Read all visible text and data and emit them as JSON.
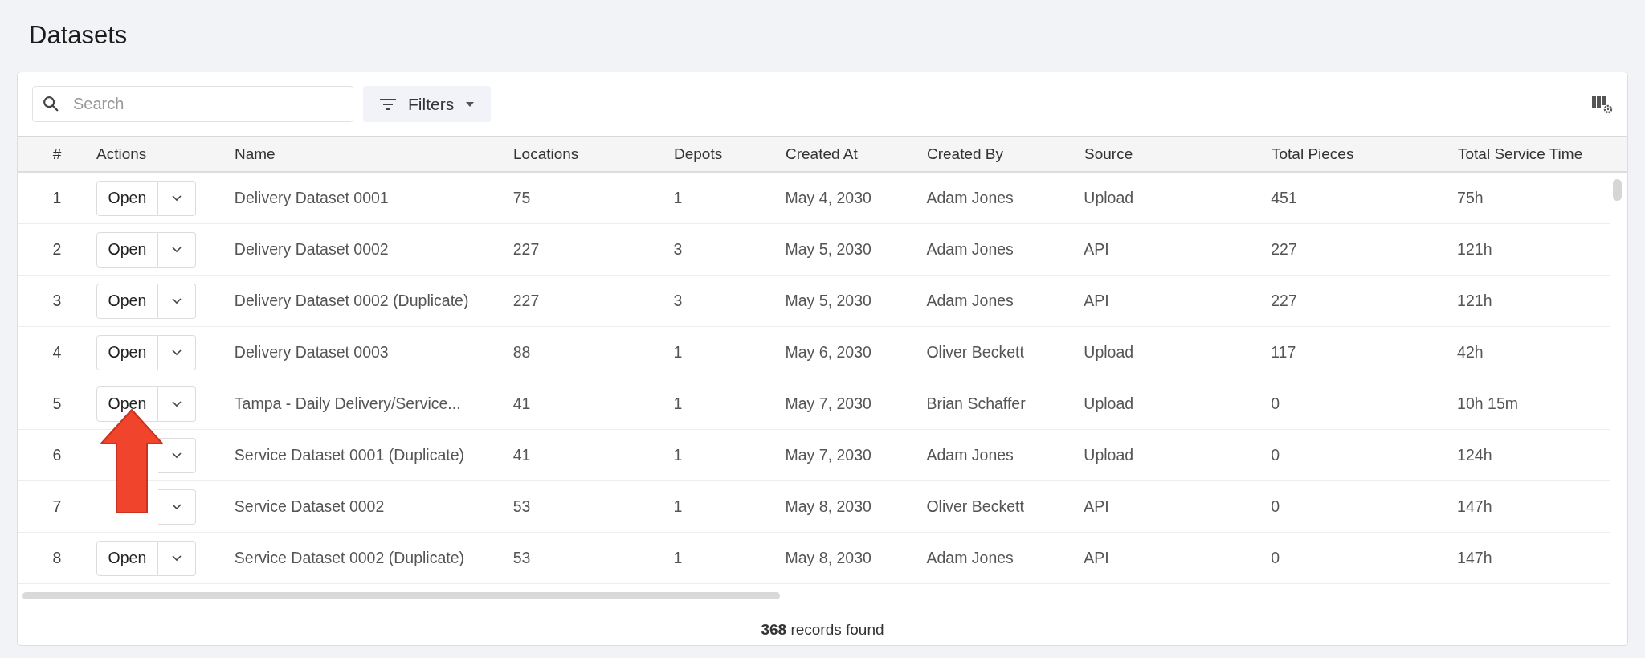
{
  "page": {
    "title": "Datasets"
  },
  "toolbar": {
    "search": {
      "placeholder": "Search"
    },
    "filters_button": "Filters"
  },
  "table": {
    "columns": [
      "#",
      "Actions",
      "Name",
      "Locations",
      "Depots",
      "Created At",
      "Created By",
      "Source",
      "Total Pieces",
      "Total Service Time"
    ],
    "rows": [
      {
        "number": "1",
        "open_label": "Open",
        "name": "Delivery Dataset 0001",
        "locations": "75",
        "depots": "1",
        "created_at": "May 4, 2030",
        "created_by": "Adam Jones",
        "source": "Upload",
        "total_pieces": "451",
        "total_service_time": "75h"
      },
      {
        "number": "2",
        "open_label": "Open",
        "name": "Delivery Dataset 0002",
        "locations": "227",
        "depots": "3",
        "created_at": "May 5, 2030",
        "created_by": "Adam Jones",
        "source": "API",
        "total_pieces": "227",
        "total_service_time": "121h"
      },
      {
        "number": "3",
        "open_label": "Open",
        "name": "Delivery Dataset 0002 (Duplicate)",
        "locations": "227",
        "depots": "3",
        "created_at": "May 5, 2030",
        "created_by": "Adam Jones",
        "source": "API",
        "total_pieces": "227",
        "total_service_time": "121h"
      },
      {
        "number": "4",
        "open_label": "Open",
        "name": "Delivery Dataset 0003",
        "locations": "88",
        "depots": "1",
        "created_at": "May 6, 2030",
        "created_by": "Oliver Beckett",
        "source": "Upload",
        "total_pieces": "117",
        "total_service_time": "42h"
      },
      {
        "number": "5",
        "open_label": "Open",
        "name": "Tampa - Daily Delivery/Service...",
        "locations": "41",
        "depots": "1",
        "created_at": "May 7, 2030",
        "created_by": "Brian Schaffer",
        "source": "Upload",
        "total_pieces": "0",
        "total_service_time": "10h 15m"
      },
      {
        "number": "6",
        "name": "Service Dataset 0001 (Duplicate)",
        "locations": "41",
        "depots": "1",
        "created_at": "May 7, 2030",
        "created_by": "Adam Jones",
        "source": "Upload",
        "total_pieces": "0",
        "total_service_time": "124h"
      },
      {
        "number": "7",
        "name": "Service Dataset 0002",
        "locations": "53",
        "depots": "1",
        "created_at": "May 8, 2030",
        "created_by": "Oliver Beckett",
        "source": "API",
        "total_pieces": "0",
        "total_service_time": "147h"
      },
      {
        "number": "8",
        "open_label": "Open",
        "name": "Service Dataset 0002 (Duplicate)",
        "locations": "53",
        "depots": "1",
        "created_at": "May 8, 2030",
        "created_by": "Adam Jones",
        "source": "API",
        "total_pieces": "0",
        "total_service_time": "147h"
      }
    ]
  },
  "footer": {
    "count": "368",
    "text": "records found"
  }
}
